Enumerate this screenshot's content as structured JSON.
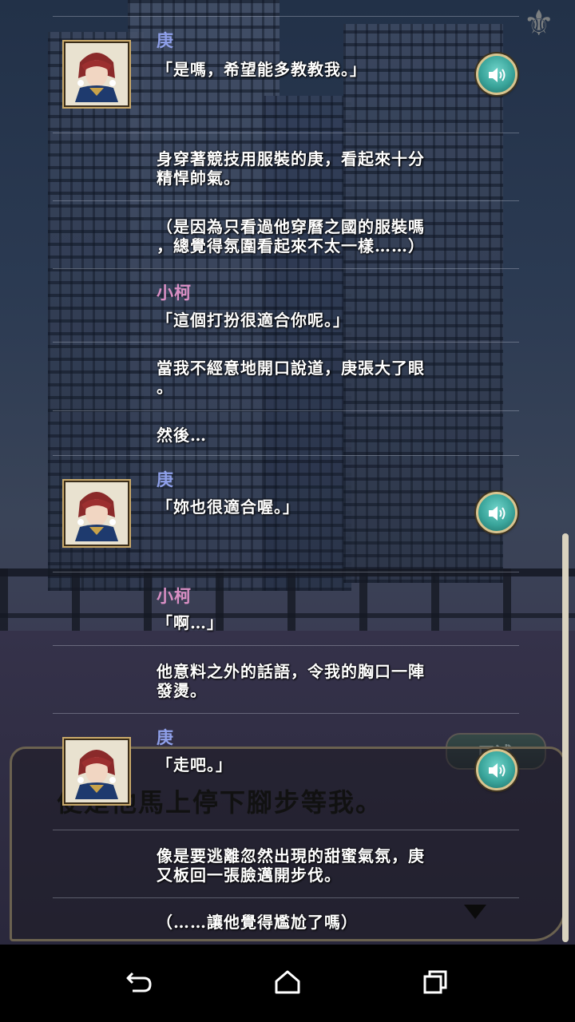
{
  "scene": {
    "fleur_icon": "⚜",
    "dialog_background_text": "便是他馬上停下腳步等我。",
    "dialog_tab_label": "口述"
  },
  "speakers": {
    "geng": "庚",
    "xiaoke": "小柯"
  },
  "log": [
    {
      "type": "dialogue",
      "speaker": "庚",
      "text": "「是嗎，希望能多教教我。」",
      "voice": true
    },
    {
      "type": "narration",
      "text": "身穿著競技用服裝的庚，看起來十分\n精悍帥氣。"
    },
    {
      "type": "narration",
      "text": "（是因為只看過他穿曆之國的服裝嗎\n，總覺得氛圍看起來不太一樣……）"
    },
    {
      "type": "dialogue",
      "speaker": "小柯",
      "text": "「這個打扮很適合你呢。」",
      "voice": false
    },
    {
      "type": "narration",
      "text": "當我不經意地開口說道，庚張大了眼\n。"
    },
    {
      "type": "narration",
      "text": "然後…"
    },
    {
      "type": "dialogue",
      "speaker": "庚",
      "text": "「妳也很適合喔。」",
      "voice": true
    },
    {
      "type": "dialogue",
      "speaker": "小柯",
      "text": "「啊…」",
      "voice": false
    },
    {
      "type": "narration",
      "text": "他意料之外的話語，令我的胸口一陣\n發燙。"
    },
    {
      "type": "dialogue",
      "speaker": "庚",
      "text": "「走吧。」",
      "voice": true
    },
    {
      "type": "narration",
      "text": "像是要逃離忽然出現的甜蜜氣氛，庚\n又板回一張臉邁開步伐。"
    },
    {
      "type": "narration",
      "text": "（……讓他覺得尷尬了嗎）"
    }
  ],
  "icons": {
    "voice": "speaker-icon",
    "back": "back-arrow-icon",
    "home": "home-icon",
    "recents": "recents-icon",
    "advance": "triangle-down-icon"
  },
  "colors": {
    "speaker_geng": "#8fa0ea",
    "speaker_xiaoke": "#d98fc4",
    "voice_button": "#3aa59b"
  }
}
